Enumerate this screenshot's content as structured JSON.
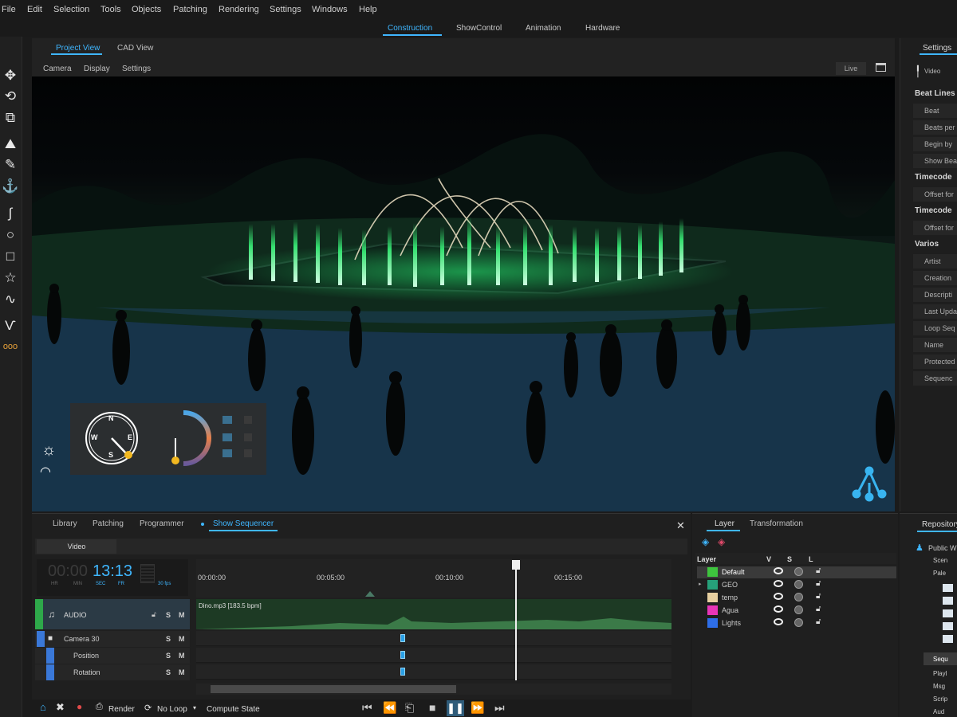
{
  "menu": [
    "File",
    "Edit",
    "Selection",
    "Tools",
    "Objects",
    "Patching",
    "Rendering",
    "Settings",
    "Windows",
    "Help"
  ],
  "mode_tabs": [
    "Construction",
    "ShowControl",
    "Animation",
    "Hardware"
  ],
  "active_mode": "Construction",
  "viewport": {
    "tabs": [
      "Project View",
      "CAD View"
    ],
    "subtabs": [
      "Camera",
      "Display",
      "Settings"
    ],
    "live_label": "Live",
    "compass": {
      "n": "N",
      "e": "E",
      "s": "S",
      "w": "W"
    }
  },
  "settings_panel": {
    "tab": "Settings",
    "video_label": "Video",
    "sections": [
      {
        "title": "Beat Lines",
        "rows": [
          "Beat",
          "Beats per",
          "Begin by",
          "Show Bea"
        ]
      },
      {
        "title": "Timecode",
        "rows": [
          "Offset for"
        ]
      },
      {
        "title": "Timecode",
        "rows": [
          "Offset for"
        ]
      },
      {
        "title": "Varios",
        "rows": [
          "Artist",
          "Creation",
          "Descripti",
          "Last Upda",
          "Loop Seq",
          "Name",
          "Protected",
          "Sequenc"
        ]
      }
    ]
  },
  "sequencer": {
    "tabs": [
      "Library",
      "Patching",
      "Programmer",
      "Show Sequencer"
    ],
    "video_tab": "Video",
    "time_dim": "00:00",
    "time_main": "13:13",
    "time_units": [
      "HR",
      "MIN",
      "SEC",
      "FR"
    ],
    "fps": "30 fps",
    "ruler": [
      "00:00:00",
      "00:05:00",
      "00:10:00",
      "00:15:00"
    ],
    "audio_label": "AUDIO",
    "audio_clip": "Dino.mp3  [183.5 bpm]",
    "tracks": [
      "Camera 30",
      "Position",
      "Rotation"
    ],
    "lsm": [
      "S",
      "M"
    ],
    "bottom": {
      "render": "Render",
      "loop": "No Loop",
      "compute": "Compute State"
    }
  },
  "layers": {
    "tabs": [
      "Layer",
      "Transformation"
    ],
    "headers": [
      "Layer",
      "V",
      "S",
      "L"
    ],
    "rows": [
      {
        "name": "Default",
        "color": "#3ec43e"
      },
      {
        "name": "GEO",
        "color": "#26a07a"
      },
      {
        "name": "temp",
        "color": "#e7cfa0"
      },
      {
        "name": "Agua",
        "color": "#e835b8"
      },
      {
        "name": "Lights",
        "color": "#2e6ee8"
      }
    ]
  },
  "repository": {
    "tab": "Repository",
    "items": [
      "Public W",
      "Scen",
      "Pale",
      "Sequ",
      "Playl",
      "Msg",
      "Scrip",
      "Aud"
    ]
  }
}
